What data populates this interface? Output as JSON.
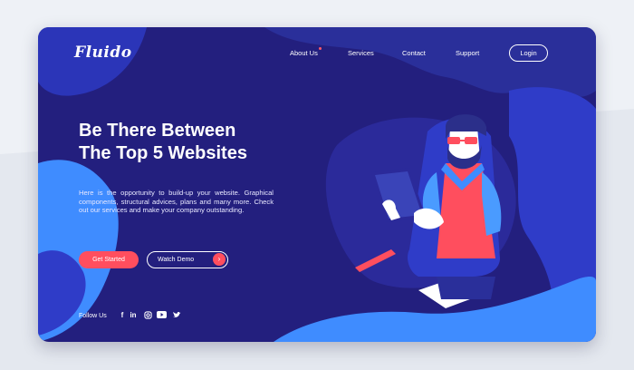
{
  "brand": {
    "logo": "Fluido"
  },
  "nav": {
    "items": [
      "About Us",
      "Services",
      "Contact",
      "Support"
    ],
    "login": "Login"
  },
  "hero": {
    "headline_line1": "Be There Between",
    "headline_line2": "The Top 5 Websites",
    "description": "Here is the opportunity to build-up your website. Graphical components, structural advices, plans and many more. Check out our services and make your company outstanding.",
    "cta_primary": "Get Started",
    "cta_secondary": "Watch Demo"
  },
  "footer": {
    "follow_label": "Follow Us",
    "social_icons": [
      "facebook-icon",
      "linkedin-icon",
      "instagram-icon",
      "youtube-icon",
      "twitter-icon"
    ]
  },
  "colors": {
    "background": "#231f7e",
    "accent": "#ff4e5e",
    "blob": "#2f3cc8",
    "blob_light": "#3f8cff"
  }
}
